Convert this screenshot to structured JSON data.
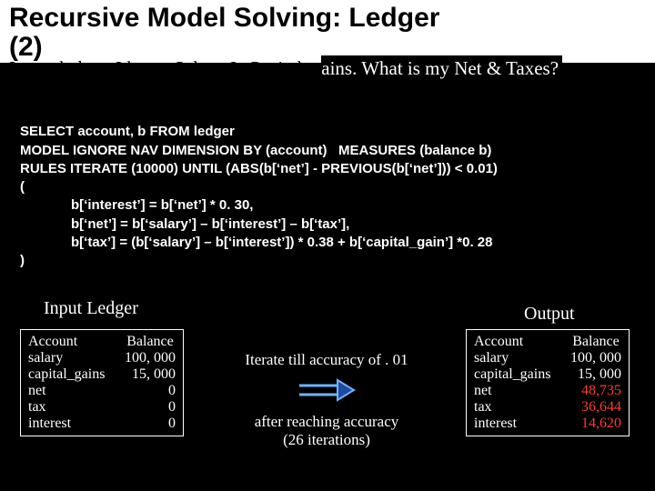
{
  "title": {
    "l1": "Recursive Model Solving: Ledger",
    "l2": "(2)"
  },
  "subtitle": {
    "prefix": "In my",
    "rest": " ledger, I know Salary & Capital_gains. What is my Net & Taxes?",
    "white_start_index": 34
  },
  "sql": {
    "l1": "SELECT account, b FROM ledger",
    "l2": "MODEL IGNORE NAV DIMENSION BY (account)   MEASURES (balance b)",
    "l3": "RULES ITERATE (10000) UNTIL (ABS(b[‘net’] - PREVIOUS(b[‘net’])) < 0.01)",
    "l4": "(",
    "r1": "b[‘interest’] = b[‘net’] * 0. 30,",
    "r2": "b[‘net’] = b[‘salary’] – b[‘interest’] – b[‘tax’],",
    "r3": "b[‘tax’] = (b[‘salary’] – b[‘interest’]) * 0.38 + b[‘capital_gain’] *0. 28",
    "l5": ")"
  },
  "headers": {
    "left": "Input Ledger",
    "right": "Output"
  },
  "input_table": {
    "cols": [
      "Account",
      "Balance"
    ],
    "rows": [
      [
        "salary",
        "100, 000"
      ],
      [
        "capital_gains",
        "15, 000"
      ],
      [
        "net",
        "0"
      ],
      [
        "tax",
        "0"
      ],
      [
        "interest",
        "0"
      ]
    ]
  },
  "output_table": {
    "cols": [
      "Account",
      "Balance"
    ],
    "rows": [
      [
        "salary",
        "100, 000",
        false
      ],
      [
        "capital_gains",
        "15, 000",
        false
      ],
      [
        "net",
        "48,735",
        true
      ],
      [
        "tax",
        "36,644",
        true
      ],
      [
        "interest",
        "14,620",
        true
      ]
    ]
  },
  "mid": {
    "line1": "Iterate till accuracy of . 01",
    "line2": "after reaching accuracy",
    "line3": "(26 iterations)"
  },
  "colors": {
    "accent_red": "#ff3b30",
    "arrow_stroke": "#6fb3ff",
    "arrow_fill": "#1f4aa0"
  }
}
